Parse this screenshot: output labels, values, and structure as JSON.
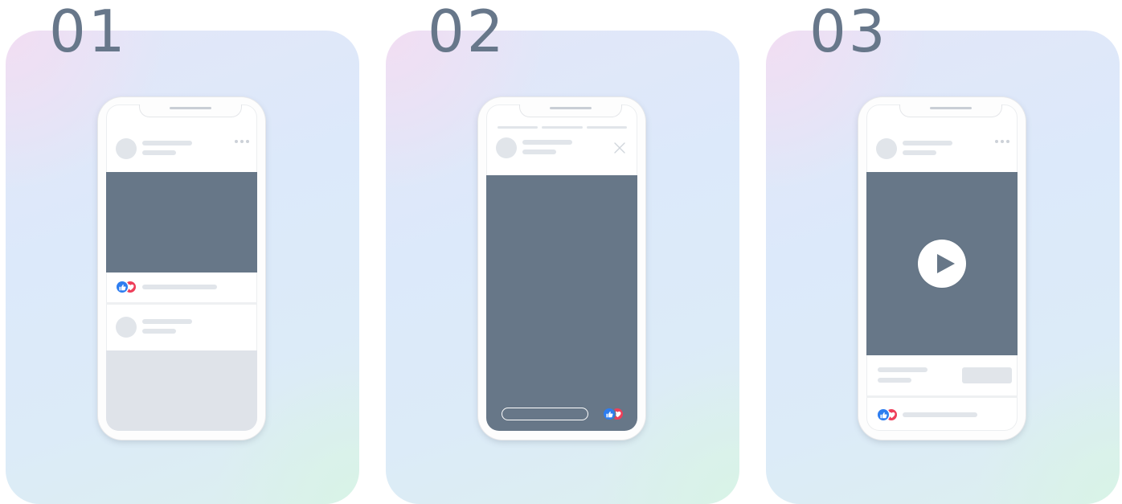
{
  "colors": {
    "slide_number": "#67778a",
    "media_placeholder": "#677788",
    "skeleton": "#e1e5ea",
    "like_reaction": "#2d7df0",
    "love_reaction": "#ee3f5a"
  },
  "panels": [
    {
      "number": "01",
      "format": "feed-post"
    },
    {
      "number": "02",
      "format": "story"
    },
    {
      "number": "03",
      "format": "video-post"
    }
  ],
  "icons": {
    "more": "more-dots-icon",
    "close": "close-icon",
    "like": "like-reaction-icon",
    "love": "love-reaction-icon",
    "play": "play-icon"
  }
}
